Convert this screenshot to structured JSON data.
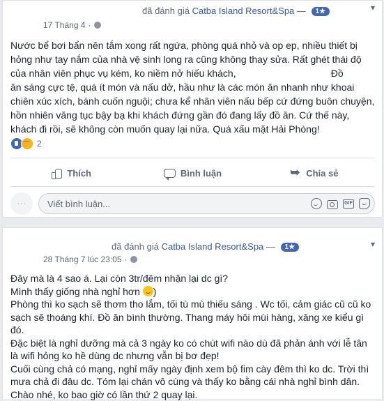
{
  "posts": [
    {
      "header": {
        "prefix": "đã đánh giá",
        "place": "Catba Island Resort&Spa",
        "dash": "—",
        "badge": "1★",
        "date": "17 Tháng 4",
        "date_sep": "·"
      },
      "body": [
        "Nước bể bơi bẩn nên tắm xong rất ngứa, phòng quá nhỏ và op ep, nhiều thiết bị",
        "hỏng như tay nắm của nhà vệ sinh long ra cũng không thay sửa. Rất ghét thái độ",
        "của nhân viên phục vụ kém, ko niềm nở hiếu khách,                                   Đồ",
        "ăn sáng cực tệ, quá ít món và nấu dở, hầu như là các món ăn nhanh như khoai",
        "chiên xúc xích, bánh cuốn nguội; chưa kể nhân viên nấu bếp cứ đứng buôn chuyện,",
        "hồn nhiên văng tục bậy bạ khi khách đứng gần đó đang lấy đồ ăn. Cứ thế này,",
        "khách đi rồi, sẽ không còn muốn quay lại nữa. Quá xấu mặt Hải Phòng!"
      ],
      "reaction_count": "2",
      "actions": {
        "like": "Thích",
        "comment": "Bình luận",
        "share": "Chia sẻ"
      },
      "comment_placeholder": "Viết bình luận...",
      "comment_icons": [
        "smile-icon",
        "camera-icon",
        "gif-icon",
        "sticker-icon"
      ],
      "gif_text": "GIF"
    },
    {
      "header": {
        "prefix": "đã đánh giá",
        "place": "Catba Island Resort&Spa",
        "dash": "—",
        "badge": "1★",
        "date": "28 Tháng 7 lúc 23:05",
        "date_sep": "·"
      },
      "body": [
        "Đây mà là 4 sao á. Lại còn 3tr/đêm nhận lại dc gì?",
        "Mình thấy giống nhà nghỉ hơn",
        "Phòng thì ko sạch sẽ thơm tho lắm, tối tù mù thiếu sáng . Wc tối, cảm giác cũ cũ ko",
        "sạch sẽ thoáng khí. Đồ ăn bình thường. Thang máy hôi mùi hàng, xăng xe kiểu gì",
        "đó.",
        "Đặc biệt là nghỉ dưỡng mà cả 3 ngày ko có chút wifi nào dù đã phản ánh với lễ tân",
        "là wifi hỏng ko hề dùng dc nhưng vẫn bị bơ đẹp!",
        "Cuối cùng chả có mạng, nghỉ mấy ngày định xem bộ fim cày đêm thì ko dc. Trời thì",
        "mưa chả đi đâu dc. Tóm lại chán vô cùng và thấy ko bằng cái nhà nghỉ bình dân.",
        "Chào nhé, ko bao giờ có lần thứ 2 quay lại."
      ],
      "line2_suffix": ")"
    }
  ],
  "colors": {
    "link": "#385898",
    "badge": "#4267b2",
    "meta": "#606770",
    "text": "#1d2129",
    "bg": "#e9ebee"
  }
}
